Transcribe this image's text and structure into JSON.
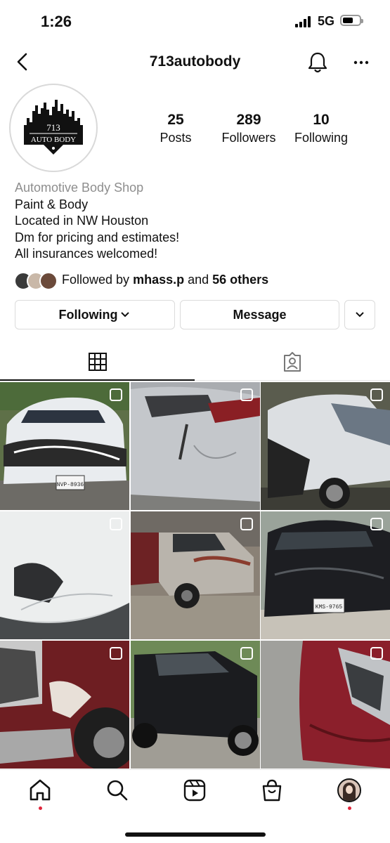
{
  "status_bar": {
    "time": "1:26",
    "network": "5G"
  },
  "header": {
    "username": "713autobody"
  },
  "avatar": {
    "logo_line1": "713",
    "logo_line2": "AUTO BODY"
  },
  "stats": {
    "posts": {
      "count": "25",
      "label": "Posts"
    },
    "followers": {
      "count": "289",
      "label": "Followers"
    },
    "following": {
      "count": "10",
      "label": "Following"
    }
  },
  "bio": {
    "category": "Automotive Body Shop",
    "lines": [
      "Paint & Body",
      "Located in NW Houston",
      "Dm for pricing and estimates!",
      "All insurances welcomed!"
    ]
  },
  "followed_by": {
    "prefix": "Followed by ",
    "user": "mhass.p",
    "middle": " and ",
    "others": "56 others"
  },
  "buttons": {
    "following": "Following",
    "message": "Message"
  },
  "tabs": [
    "grid",
    "tagged"
  ],
  "posts": [
    {
      "description": "White sedan front-end damage",
      "plate": "NVP-8936",
      "multi": true
    },
    {
      "description": "Silver car rear quarter panel damage",
      "multi": true
    },
    {
      "description": "White sedan crushed front corner",
      "multi": true
    },
    {
      "description": "White bumper dent close-up",
      "multi": true
    },
    {
      "description": "Red and white pickup truck",
      "multi": true
    },
    {
      "description": "Black sedan damaged front",
      "plate": "KMS-9765",
      "multi": true
    },
    {
      "description": "Red truck fender scrape",
      "multi": true
    },
    {
      "description": "Black pickup truck",
      "multi": true
    },
    {
      "description": "Red car headlight damage",
      "multi": true
    }
  ],
  "colors": {
    "accent": "#e0243b",
    "border": "#dbdbdb",
    "muted": "#8e8e8e"
  }
}
